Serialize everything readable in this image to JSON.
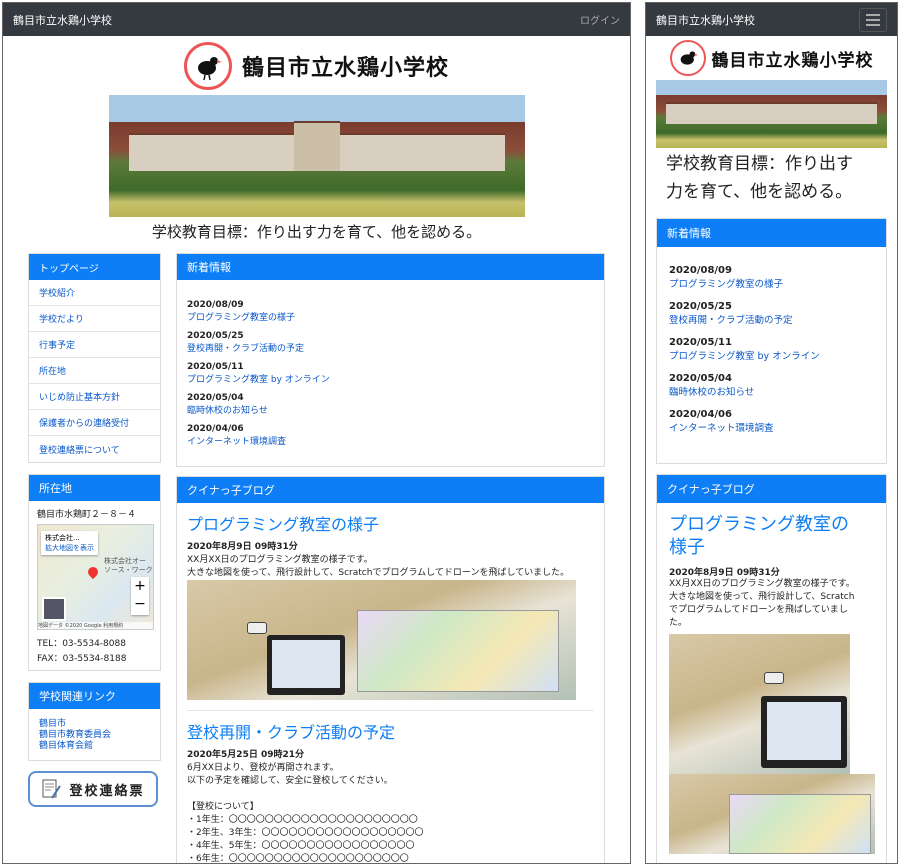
{
  "header": {
    "site_name": "鶴目市立水鶏小学校",
    "login_label": "ログイン"
  },
  "logo": {
    "title": "鶴目市立水鶏小学校"
  },
  "goal": {
    "desktop": "学校教育目標：作り出す力を育て、他を認める。",
    "mobile_line1": "学校教育目標：作り出す",
    "mobile_line2": "力を育て、他を認める。"
  },
  "sidebar": {
    "nav_title": "トップページ",
    "items": [
      {
        "label": "学校紹介"
      },
      {
        "label": "学校だより"
      },
      {
        "label": "行事予定"
      },
      {
        "label": "所在地"
      },
      {
        "label": "いじめ防止基本方針"
      },
      {
        "label": "保護者からの連絡受付"
      },
      {
        "label": "登校連絡票について"
      }
    ],
    "location_title": "所在地",
    "address": "鶴目市水鶏町２－８－４",
    "map_popup_title": "株式会社...",
    "map_popup_link": "拡大地図を表示",
    "map_label_1": "株式会社オー",
    "map_label_2": "ソース・ワーク",
    "map_credit": "地図データ ©2020 Google  利用規約",
    "tel": "TEL：03-5534-8088",
    "fax": "FAX：03-5534-8188",
    "links_title": "学校関連リンク",
    "links": [
      {
        "label": "鶴目市"
      },
      {
        "label": "鶴目市教育委員会"
      },
      {
        "label": "鶴目体育会館"
      }
    ],
    "toko_button": "登校連絡票"
  },
  "news": {
    "title": "新着情報",
    "items": [
      {
        "date": "2020/08/09",
        "text": "プログラミング教室の様子"
      },
      {
        "date": "2020/05/25",
        "text": "登校再開・クラブ活動の予定"
      },
      {
        "date": "2020/05/11",
        "text": "プログラミング教室 by オンライン"
      },
      {
        "date": "2020/05/04",
        "text": "臨時休校のお知らせ"
      },
      {
        "date": "2020/04/06",
        "text": "インターネット環境調査"
      }
    ]
  },
  "blog": {
    "title": "クイナっ子ブログ",
    "posts": [
      {
        "title": "プログラミング教室の様子",
        "mobile_title_1": "プログラミング教室の",
        "mobile_title_2": "様子",
        "date": "2020年8月9日 09時31分",
        "body_1": "XX月XX日のプログラミング教室の様子です。",
        "body_2": "大きな地図を使って、飛行設計して、Scratchでプログラムしてドローンを飛ばしていました。",
        "m_body_1": "XX月XX日のプログラミング教室の様子です。",
        "m_body_2": "大きな地図を使って、飛行設計して、Scratch",
        "m_body_3": "でプログラムしてドローンを飛ばしていまし",
        "m_body_4": "た。"
      },
      {
        "title": "登校再開・クラブ活動の予定",
        "date": "2020年5月25日 09時21分",
        "body_1": "6月XX日より、登校が再開されます。",
        "body_2": "以下の予定を確認して、安全に登校してください。",
        "section": "【登校について】",
        "lines": [
          "・1年生：〇〇〇〇〇〇〇〇〇〇〇〇〇〇〇〇〇〇〇〇〇",
          "・2年生、3年生：〇〇〇〇〇〇〇〇〇〇〇〇〇〇〇〇〇〇",
          "・4年生、5年生：〇〇〇〇〇〇〇〇〇〇〇〇〇〇〇〇〇",
          "・6年生：〇〇〇〇〇〇〇〇〇〇〇〇〇〇〇〇〇〇〇〇"
        ]
      }
    ]
  },
  "colors": {
    "primary": "#0d7ef5",
    "navbar": "#343a40",
    "link": "#0a58c9"
  }
}
